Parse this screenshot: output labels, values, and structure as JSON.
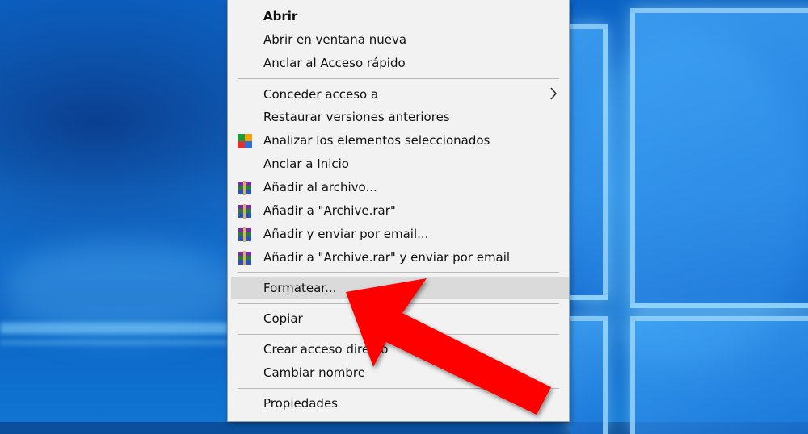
{
  "menu": {
    "items": [
      {
        "label": "Abrir"
      },
      {
        "label": "Abrir en ventana nueva"
      },
      {
        "label": "Anclar al Acceso rápido"
      },
      {
        "label": "Conceder acceso a"
      },
      {
        "label": "Restaurar versiones anteriores"
      },
      {
        "label": "Analizar los elementos seleccionados"
      },
      {
        "label": "Anclar a Inicio"
      },
      {
        "label": "Añadir al archivo..."
      },
      {
        "label": "Añadir a \"Archive.rar\""
      },
      {
        "label": "Añadir y enviar por email..."
      },
      {
        "label": "Añadir a \"Archive.rar\" y enviar por email"
      },
      {
        "label": "Formatear..."
      },
      {
        "label": "Copiar"
      },
      {
        "label": "Crear acceso directo"
      },
      {
        "label": "Cambiar nombre"
      },
      {
        "label": "Propiedades"
      }
    ],
    "highlighted_item": "Formatear..."
  },
  "icons": {
    "antivirus": "avg-scan-icon",
    "archive": "winrar-books-icon",
    "submenu": "chevron-right-icon"
  },
  "colors": {
    "menu_background": "#f2f2f2",
    "highlight": "#dadada",
    "separator": "#b8b8b8",
    "arrow": "#ff0000",
    "desktop": "#0a66c8"
  }
}
